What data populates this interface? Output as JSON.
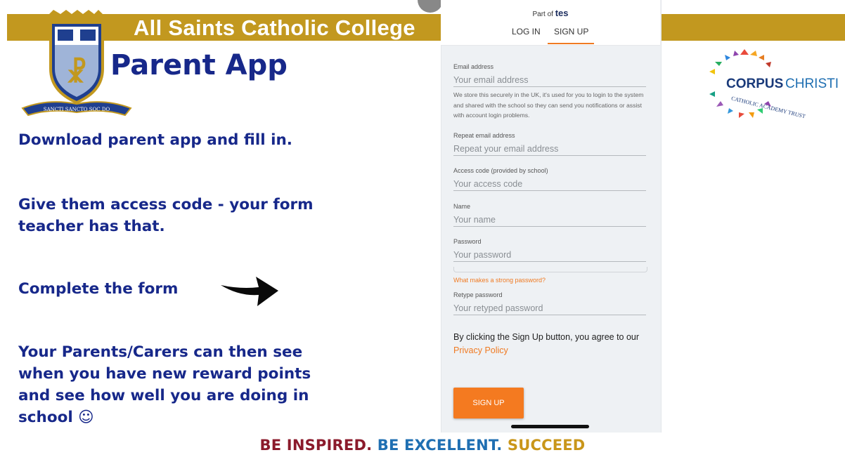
{
  "slide": {
    "college_name": "All Saints Catholic College",
    "app_title": "Parent App",
    "crest_motto": "SANCTI SANCTO SOC DO",
    "instructions": [
      "Download parent app and fill in.",
      "Give them access code - your form teacher has that.",
      "Complete the form",
      "Your Parents/Carers can then see when you have new reward points and see how well you are doing in school ☺"
    ],
    "tagline_parts": [
      "BE INSPIRED.",
      "BE EXCELLENT.",
      "SUCCEED"
    ],
    "tagline_colors": [
      "#8b1a2b",
      "#1f6fb2",
      "#c9961a"
    ],
    "corpus_logo": {
      "word1": "CORPUS",
      "word2": "CHRISTI",
      "ring_text": "CATHOLIC ACADEMY TRUST",
      "colors": [
        "#1a3a7a",
        "#1f6fb2"
      ]
    },
    "banner_color": "#c2981f",
    "title_color": "#17288a"
  },
  "phone": {
    "part_of": "Part of",
    "brand": "tes",
    "tabs": {
      "login": "LOG IN",
      "signup": "SIGN UP"
    },
    "fields": {
      "email": {
        "label": "Email address",
        "placeholder": "Your email address"
      },
      "email_help": "We store this securely in the UK, it's used for you to login to the system and shared with the school so they can send you notifications or assist with account login problems.",
      "repeat_email": {
        "label": "Repeat email address",
        "placeholder": "Repeat your email address"
      },
      "access_code": {
        "label": "Access code (provided by school)",
        "placeholder": "Your access code"
      },
      "name": {
        "label": "Name",
        "placeholder": "Your name"
      },
      "password": {
        "label": "Password",
        "placeholder": "Your password"
      },
      "strong_password_link": "What makes a strong password?",
      "retype": {
        "label": "Retype password",
        "placeholder": "Your retyped password"
      }
    },
    "agree_text": "By clicking the Sign Up button, you agree to our",
    "privacy_link": "Privacy Policy",
    "signup_button": "SIGN UP",
    "accent_color": "#f07a22"
  }
}
